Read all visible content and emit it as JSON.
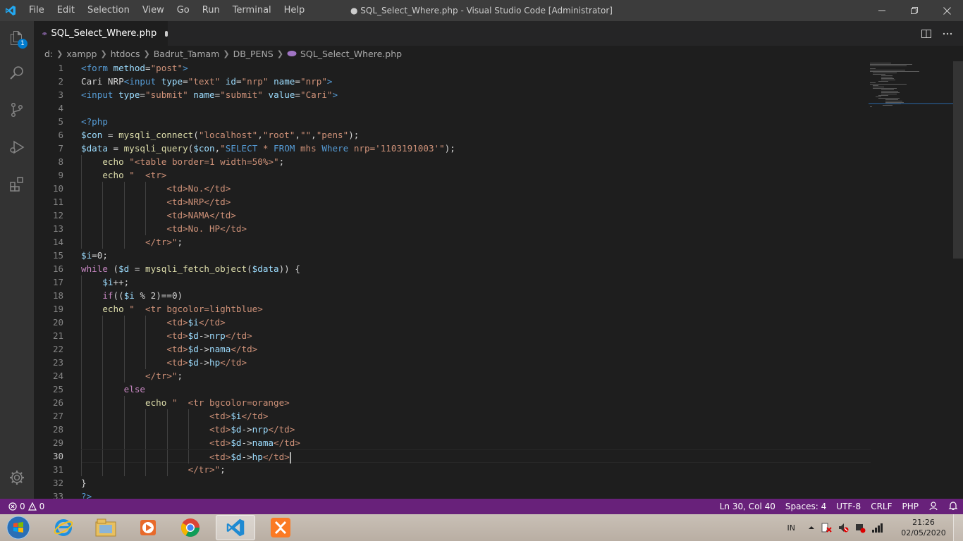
{
  "window": {
    "title": "● SQL_Select_Where.php - Visual Studio Code [Administrator]"
  },
  "menu": [
    "File",
    "Edit",
    "Selection",
    "View",
    "Go",
    "Run",
    "Terminal",
    "Help"
  ],
  "activity_bar": {
    "explorer_badge": "1",
    "items": [
      "explorer-icon",
      "search-icon",
      "source-control-icon",
      "run-debug-icon",
      "extensions-icon"
    ],
    "bottom": "settings-gear-icon"
  },
  "tab": {
    "label": "SQL_Select_Where.php",
    "modified": true
  },
  "breadcrumbs": [
    "d:",
    "xampp",
    "htdocs",
    "Badrut_Tamam",
    "DB_PENS",
    "SQL_Select_Where.php"
  ],
  "editor": {
    "line_numbers": [
      "1",
      "2",
      "3",
      "4",
      "5",
      "6",
      "7",
      "8",
      "9",
      "10",
      "11",
      "12",
      "13",
      "14",
      "15",
      "16",
      "17",
      "18",
      "19",
      "20",
      "21",
      "22",
      "23",
      "24",
      "25",
      "26",
      "27",
      "28",
      "29",
      "30",
      "31",
      "32",
      "33"
    ],
    "current_line": 30,
    "lines": [
      [
        [
          "tag",
          "<form "
        ],
        [
          "attr",
          "method"
        ],
        [
          "def",
          "="
        ],
        [
          "str",
          "\"post\""
        ],
        [
          "tag",
          ">"
        ]
      ],
      [
        [
          "def",
          "Cari NRP"
        ],
        [
          "tag",
          "<input "
        ],
        [
          "attr",
          "type"
        ],
        [
          "def",
          "="
        ],
        [
          "str",
          "\"text\""
        ],
        [
          "def",
          " "
        ],
        [
          "attr",
          "id"
        ],
        [
          "def",
          "="
        ],
        [
          "str",
          "\"nrp\""
        ],
        [
          "def",
          " "
        ],
        [
          "attr",
          "name"
        ],
        [
          "def",
          "="
        ],
        [
          "str",
          "\"nrp\""
        ],
        [
          "tag",
          ">"
        ]
      ],
      [
        [
          "tag",
          "<input "
        ],
        [
          "attr",
          "type"
        ],
        [
          "def",
          "="
        ],
        [
          "str",
          "\"submit\""
        ],
        [
          "def",
          " "
        ],
        [
          "attr",
          "name"
        ],
        [
          "def",
          "="
        ],
        [
          "str",
          "\"submit\""
        ],
        [
          "def",
          " "
        ],
        [
          "attr",
          "value"
        ],
        [
          "def",
          "="
        ],
        [
          "str",
          "\"Cari\""
        ],
        [
          "tag",
          ">"
        ]
      ],
      [],
      [
        [
          "php",
          "<?php"
        ]
      ],
      [
        [
          "var",
          "$con"
        ],
        [
          "def",
          " = "
        ],
        [
          "fn",
          "mysqli_connect"
        ],
        [
          "def",
          "("
        ],
        [
          "str",
          "\"localhost\""
        ],
        [
          "def",
          ","
        ],
        [
          "str",
          "\"root\""
        ],
        [
          "def",
          ","
        ],
        [
          "str",
          "\"\""
        ],
        [
          "def",
          ","
        ],
        [
          "str",
          "\"pens\""
        ],
        [
          "def",
          ");"
        ]
      ],
      [
        [
          "var",
          "$data"
        ],
        [
          "def",
          " = "
        ],
        [
          "fn",
          "mysqli_query"
        ],
        [
          "def",
          "("
        ],
        [
          "var",
          "$con"
        ],
        [
          "def",
          ","
        ],
        [
          "str",
          "\""
        ],
        [
          "php",
          "SELECT"
        ],
        [
          "str",
          " * "
        ],
        [
          "php",
          "FROM"
        ],
        [
          "str",
          " mhs "
        ],
        [
          "php",
          "Where"
        ],
        [
          "str",
          " nrp='1103191003'\""
        ],
        [
          "def",
          ");"
        ]
      ],
      [
        [
          "def",
          "    "
        ],
        [
          "fn",
          "echo"
        ],
        [
          "def",
          " "
        ],
        [
          "str",
          "\"<table border=1 width=50%>\""
        ],
        [
          "def",
          ";"
        ]
      ],
      [
        [
          "def",
          "    "
        ],
        [
          "fn",
          "echo"
        ],
        [
          "def",
          " "
        ],
        [
          "str",
          "\"  <tr>"
        ]
      ],
      [
        [
          "str",
          "                <td>No.</td>"
        ]
      ],
      [
        [
          "str",
          "                <td>NRP</td>"
        ]
      ],
      [
        [
          "str",
          "                <td>NAMA</td>"
        ]
      ],
      [
        [
          "str",
          "                <td>No. HP</td>"
        ]
      ],
      [
        [
          "str",
          "            </tr>\""
        ],
        [
          "def",
          ";"
        ]
      ],
      [
        [
          "var",
          "$i"
        ],
        [
          "def",
          "="
        ],
        [
          "def",
          "0;"
        ]
      ],
      [
        [
          "kw",
          "while"
        ],
        [
          "def",
          " ("
        ],
        [
          "var",
          "$d"
        ],
        [
          "def",
          " = "
        ],
        [
          "fn",
          "mysqli_fetch_object"
        ],
        [
          "def",
          "("
        ],
        [
          "var",
          "$data"
        ],
        [
          "def",
          ")) {"
        ]
      ],
      [
        [
          "def",
          "    "
        ],
        [
          "var",
          "$i"
        ],
        [
          "def",
          "++;"
        ]
      ],
      [
        [
          "def",
          "    "
        ],
        [
          "kw",
          "if"
        ],
        [
          "def",
          "(("
        ],
        [
          "var",
          "$i"
        ],
        [
          "def",
          " % 2)=="
        ],
        [
          "def",
          "0)"
        ]
      ],
      [
        [
          "def",
          "    "
        ],
        [
          "fn",
          "echo"
        ],
        [
          "def",
          " "
        ],
        [
          "str",
          "\"  <tr bgcolor=lightblue>"
        ]
      ],
      [
        [
          "str",
          "                <td>"
        ],
        [
          "var",
          "$i"
        ],
        [
          "str",
          "</td>"
        ]
      ],
      [
        [
          "str",
          "                <td>"
        ],
        [
          "var",
          "$d"
        ],
        [
          "def",
          "->"
        ],
        [
          "var",
          "nrp"
        ],
        [
          "str",
          "</td>"
        ]
      ],
      [
        [
          "str",
          "                <td>"
        ],
        [
          "var",
          "$d"
        ],
        [
          "def",
          "->"
        ],
        [
          "var",
          "nama"
        ],
        [
          "str",
          "</td>"
        ]
      ],
      [
        [
          "str",
          "                <td>"
        ],
        [
          "var",
          "$d"
        ],
        [
          "def",
          "->"
        ],
        [
          "var",
          "hp"
        ],
        [
          "str",
          "</td>"
        ]
      ],
      [
        [
          "str",
          "            </tr>\""
        ],
        [
          "def",
          ";"
        ]
      ],
      [
        [
          "def",
          "        "
        ],
        [
          "kw",
          "else"
        ]
      ],
      [
        [
          "def",
          "            "
        ],
        [
          "fn",
          "echo"
        ],
        [
          "def",
          " "
        ],
        [
          "str",
          "\"  <tr bgcolor=orange>"
        ]
      ],
      [
        [
          "str",
          "                        <td>"
        ],
        [
          "var",
          "$i"
        ],
        [
          "str",
          "</td>"
        ]
      ],
      [
        [
          "str",
          "                        <td>"
        ],
        [
          "var",
          "$d"
        ],
        [
          "def",
          "->"
        ],
        [
          "var",
          "nrp"
        ],
        [
          "str",
          "</td>"
        ]
      ],
      [
        [
          "str",
          "                        <td>"
        ],
        [
          "var",
          "$d"
        ],
        [
          "def",
          "->"
        ],
        [
          "var",
          "nama"
        ],
        [
          "str",
          "</td>"
        ]
      ],
      [
        [
          "str",
          "                        <td>"
        ],
        [
          "var",
          "$d"
        ],
        [
          "def",
          "->"
        ],
        [
          "var",
          "hp"
        ],
        [
          "str",
          "</td>"
        ]
      ],
      [
        [
          "str",
          "                    </tr>\""
        ],
        [
          "def",
          ";"
        ]
      ],
      [
        [
          "def",
          "}"
        ]
      ],
      [
        [
          "php",
          "?>"
        ]
      ]
    ]
  },
  "status_bar": {
    "errors": "0",
    "warnings": "0",
    "position": "Ln 30, Col 40",
    "spaces": "Spaces: 4",
    "encoding": "UTF-8",
    "eol": "CRLF",
    "language": "PHP"
  },
  "taskbar": {
    "apps": [
      "internet-explorer-icon",
      "file-explorer-icon",
      "media-player-icon",
      "chrome-icon",
      "vscode-icon",
      "xampp-icon"
    ],
    "active_app": "vscode-icon",
    "language": "IN",
    "time": "21:26",
    "date": "02/05/2020"
  },
  "colors": {
    "status_bar": "#68217a",
    "title_bar": "#3c3c3c",
    "activity_bar": "#333333",
    "editor_bg": "#1e1e1e"
  }
}
